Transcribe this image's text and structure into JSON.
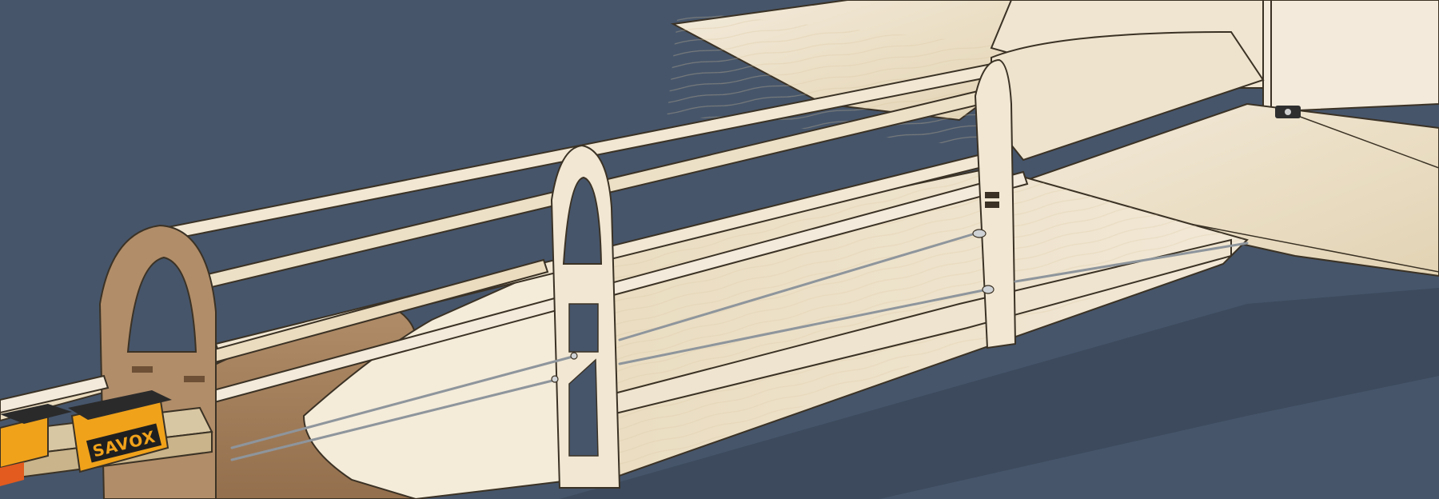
{
  "scene": {
    "subject": "balsa-fuselage-tail-section",
    "colors": {
      "background": "#46556a",
      "shadow": "#3a4658",
      "balsa_light": "#f1e7d3",
      "balsa_mid": "#e8dcc1",
      "balsa_dark": "#d9c9a8",
      "plywood": "#a88462",
      "plywood_dark": "#8c6a4a",
      "servo_body": "#f0a21a",
      "servo_case": "#2a2a2a",
      "pushrod": "#9aa0a6",
      "outline": "#3b3225"
    }
  },
  "servo": {
    "brand_label": "SAVOX"
  }
}
